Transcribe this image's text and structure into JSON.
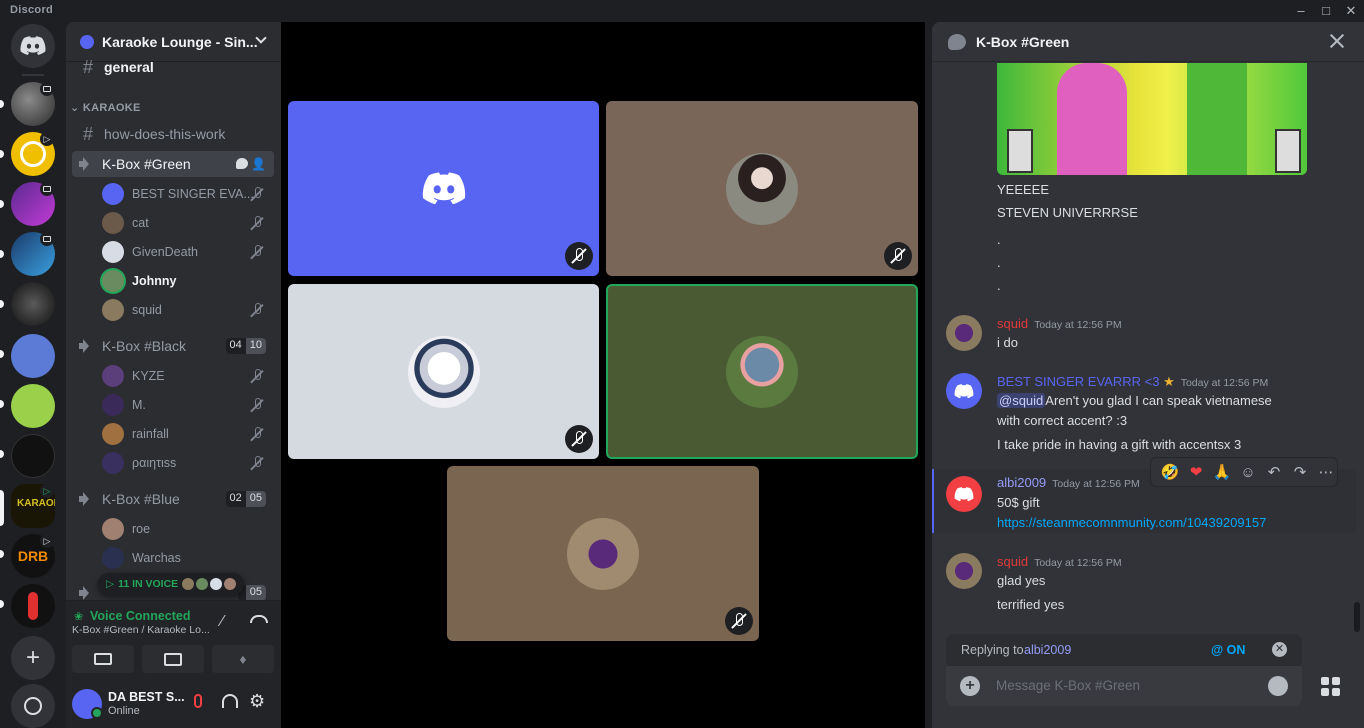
{
  "app": {
    "name": "Discord"
  },
  "colors": {
    "accent": "#5865f2",
    "online": "#23a55a",
    "danger": "#f23f43",
    "link": "#00a8fc"
  },
  "guild": {
    "name": "Karaoke Lounge - Sin..."
  },
  "channels": {
    "general": "general",
    "category": "KARAOKE",
    "how": "how-does-this-work",
    "green": {
      "name": "K-Box #Green",
      "users": [
        "BEST SINGER EVA...",
        "cat",
        "GivenDeath",
        "Johnny",
        "squid"
      ]
    },
    "black": {
      "name": "K-Box #Black",
      "count": "04",
      "limit": "10",
      "users": [
        "KYZE",
        "M.",
        "rainfall",
        "ραιητιss"
      ]
    },
    "blue": {
      "name": "K-Box #Blue",
      "count": "02",
      "limit": "05",
      "users": [
        "roe",
        "Warchas"
      ]
    },
    "next_limit": "05"
  },
  "in_voice": {
    "label": "11 IN VOICE"
  },
  "voice": {
    "status": "Voice Connected",
    "location": "K-Box #Green / Karaoke Lo..."
  },
  "user": {
    "name": "DA BEST S...",
    "status": "Online"
  },
  "chat": {
    "title": "K-Box #Green",
    "lines_top": [
      "YEEEEE",
      "STEVEN UNIVERRRSE",
      ".",
      ".",
      "."
    ],
    "messages": [
      {
        "author": "squid",
        "time": "Today at 12:56 PM",
        "lines": [
          "i do"
        ]
      },
      {
        "author": "BEST SINGER EVARRR <3",
        "time": "Today at 12:56 PM",
        "mention": "@squid",
        "line1": "Aren't you glad I can speak vietnamese",
        "line2": "with correct accent? :3",
        "line3": "I take pride in having a gift with accentsx 3"
      },
      {
        "author": "albi2009",
        "time": "Today at 12:56 PM",
        "line1": "50$ gift",
        "link": "https://steanmecomnmunity.com/10439209157"
      },
      {
        "author": "squid",
        "time": "Today at 12:56 PM",
        "line1": "glad yes",
        "line2": "terrified yes"
      }
    ],
    "reactions": [
      "🤣",
      "❤",
      "🙏"
    ],
    "reply": {
      "prefix": "Replying to",
      "target": "albi2009",
      "ping": "@ ON"
    },
    "composer": {
      "placeholder": "Message K-Box #Green"
    }
  }
}
